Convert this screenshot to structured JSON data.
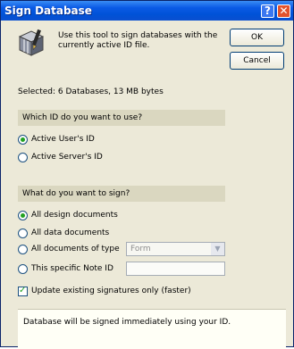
{
  "window": {
    "title": "Sign Database"
  },
  "titlebar_buttons": {
    "help": "?",
    "close": "✕"
  },
  "intro": {
    "text": "Use this tool to sign databases with the currently active ID file."
  },
  "buttons": {
    "ok": "OK",
    "cancel": "Cancel"
  },
  "selected": {
    "text": "Selected:  6 Databases, 13 MB bytes"
  },
  "id_section": {
    "heading": "Which ID do you want to use?",
    "options": [
      {
        "label": "Active User's ID",
        "selected": true
      },
      {
        "label": "Active Server's ID",
        "selected": false
      }
    ]
  },
  "sign_section": {
    "heading": "What do you want to sign?",
    "options": [
      {
        "label": "All design documents",
        "selected": true
      },
      {
        "label": "All data documents",
        "selected": false
      },
      {
        "label": "All documents of type",
        "selected": false
      },
      {
        "label": "This specific Note ID",
        "selected": false
      }
    ],
    "document_type_value": "Form",
    "note_id_value": ""
  },
  "update_option": {
    "label": "Update existing signatures only (faster)",
    "checked": true
  },
  "footer": {
    "text": "Database will be signed immediately using your ID."
  },
  "colors": {
    "titlebar": "#0a5ae6",
    "dialog_bg": "#ece9d8",
    "section_bg": "#dad7c0",
    "radio_dot": "#21a121"
  }
}
